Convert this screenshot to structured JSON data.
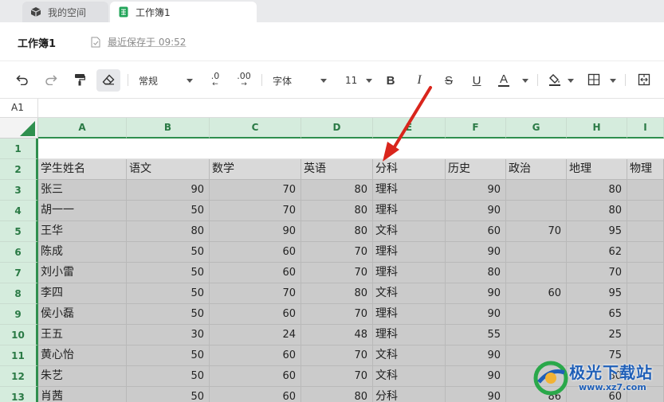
{
  "tabs": [
    {
      "label": "我的空间",
      "icon": "cube-icon"
    },
    {
      "label": "工作簿1",
      "icon": "sheet-icon"
    }
  ],
  "document": {
    "title": "工作簿1",
    "save_status": "最近保存于 09:52"
  },
  "toolbar": {
    "number_format": "常规",
    "font_family": "字体",
    "font_size": "11",
    "decrease_decimal": ".0",
    "increase_decimal": ".00",
    "bold_label": "B",
    "italic_label": "I",
    "strike_label": "S",
    "underline_label": "U",
    "font_color_label": "A",
    "font_color": "#333333"
  },
  "name_box": "A1",
  "sheet": {
    "columns": [
      "A",
      "B",
      "C",
      "D",
      "E",
      "F",
      "G",
      "H",
      "I"
    ],
    "rows": [
      "1",
      "2",
      "3",
      "4",
      "5",
      "6",
      "7",
      "8",
      "9",
      "10",
      "11",
      "12",
      "13"
    ],
    "header": [
      "学生姓名",
      "语文",
      "数学",
      "英语",
      "分科",
      "历史",
      "政治",
      "地理",
      "物理"
    ],
    "data": [
      [
        "张三",
        "90",
        "70",
        "80",
        "理科",
        "90",
        "",
        "80",
        ""
      ],
      [
        "胡一一",
        "50",
        "70",
        "80",
        "理科",
        "90",
        "",
        "80",
        ""
      ],
      [
        "王华",
        "80",
        "90",
        "80",
        "文科",
        "60",
        "70",
        "95",
        ""
      ],
      [
        "陈成",
        "50",
        "60",
        "70",
        "理科",
        "90",
        "",
        "62",
        ""
      ],
      [
        "刘小雷",
        "50",
        "60",
        "70",
        "理科",
        "80",
        "",
        "70",
        ""
      ],
      [
        "李四",
        "50",
        "70",
        "80",
        "文科",
        "90",
        "60",
        "95",
        ""
      ],
      [
        "侯小磊",
        "50",
        "60",
        "70",
        "理科",
        "90",
        "",
        "65",
        ""
      ],
      [
        "王五",
        "30",
        "24",
        "48",
        "理科",
        "55",
        "",
        "25",
        ""
      ],
      [
        "黄心怡",
        "50",
        "60",
        "70",
        "文科",
        "90",
        "",
        "75",
        ""
      ],
      [
        "朱艺",
        "50",
        "60",
        "70",
        "文科",
        "90",
        "",
        "80",
        ""
      ],
      [
        "肖茜",
        "50",
        "60",
        "80",
        "分科",
        "90",
        "86",
        "60",
        ""
      ]
    ]
  },
  "watermark": {
    "title": "极光下载站",
    "url": "www.xz7.com"
  },
  "colors": {
    "accent_green": "#2f8f4e",
    "header_green_bg": "#d5ecdd",
    "selection_gray": "#cbcbcb",
    "annotation_red": "#d9251c"
  }
}
